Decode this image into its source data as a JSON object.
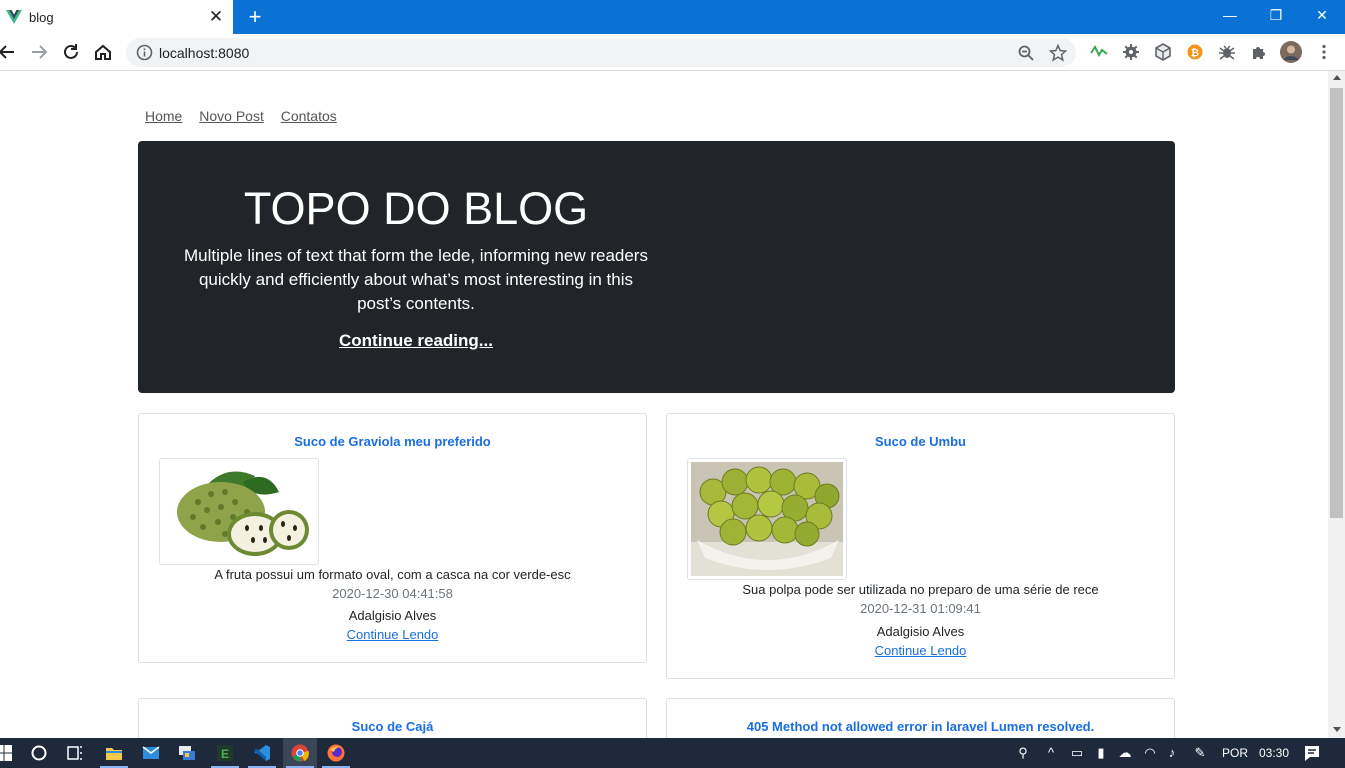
{
  "browser": {
    "tab_title": "blog",
    "tab_close": "✕",
    "new_tab": "+",
    "url": "localhost:8080",
    "window_controls": {
      "minimize": "—",
      "restore": "❐",
      "close": "✕"
    },
    "accent": "#0a72d4"
  },
  "nav": {
    "links": [
      "Home",
      "Novo Post",
      "Contatos"
    ]
  },
  "hero": {
    "title": "TOPO DO BLOG",
    "lede": "Multiple lines of text that form the lede, informing new readers quickly and efficiently about what’s most interesting in this post’s contents.",
    "link": "Continue reading...",
    "background": "#212529"
  },
  "posts": [
    {
      "title": "Suco de Graviola meu preferido",
      "image_icon": "soursop-fruit-image",
      "excerpt": "A fruta possui um formato oval, com a casca na cor verde-esc",
      "date": "2020-12-30 04:41:58",
      "author": "Adalgisio Alves",
      "link": "Continue Lendo"
    },
    {
      "title": "Suco de Umbu",
      "image_icon": "umbu-fruit-image",
      "excerpt": "Sua polpa pode ser utilizada no preparo de uma série de rece",
      "date": "2020-12-31 01:09:41",
      "author": "Adalgisio Alves",
      "link": "Continue Lendo"
    },
    {
      "title": "Suco de Cajá"
    },
    {
      "title": "405 Method not allowed error in laravel Lumen resolved."
    }
  ],
  "link_color": "#1a6fe0",
  "taskbar": {
    "language": "POR",
    "time": "03:30"
  }
}
